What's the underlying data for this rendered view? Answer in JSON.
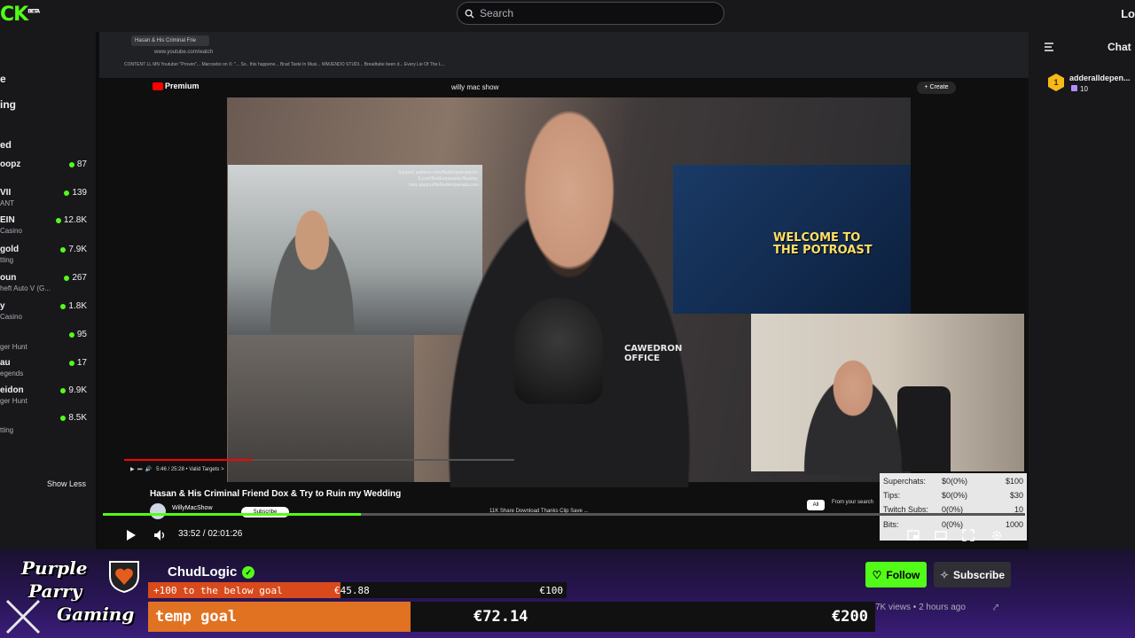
{
  "app": {
    "logo": "CK",
    "logo_badge": "BETA",
    "login_label": "Lo"
  },
  "search": {
    "placeholder": "Search"
  },
  "sidebar": {
    "headers": [
      "e",
      "ing",
      "ed"
    ],
    "items": [
      {
        "name": "oopz",
        "sub": "",
        "viewers": "87"
      },
      {
        "name": "VII",
        "sub": "ANT",
        "viewers": "139"
      },
      {
        "name": "EIN",
        "sub": "Casino",
        "viewers": "12.8K"
      },
      {
        "name": "gold",
        "sub": "tting",
        "viewers": "7.9K"
      },
      {
        "name": "oun",
        "sub": "heft Auto V (G...",
        "viewers": "267"
      },
      {
        "name": "y",
        "sub": "Casino",
        "viewers": "1.8K"
      },
      {
        "name": "",
        "sub": "ger Hunt",
        "viewers": "95"
      },
      {
        "name": "au",
        "sub": "egends",
        "viewers": "17"
      },
      {
        "name": "eidon",
        "sub": "ger Hunt",
        "viewers": "9.9K"
      },
      {
        "name": "",
        "sub": "tting",
        "viewers": "8.5K"
      }
    ],
    "show_less": "Show Less"
  },
  "embedded_browser": {
    "tab_title": "Hasan & His Criminal Frie",
    "url": "www.youtube.com/watch",
    "bookmarks": "CONTENT   LL   MN   Youtuber \"Proven\"...   Marcoebo on X: \"...   So.. this happene...   Brad Taste In Musi...   WMJENDO STUDI...   Breadtube been d...   Every Lie Of The L..."
  },
  "youtube": {
    "logo": "Premium",
    "search_value": "willy mac show",
    "create_label": "Create",
    "poster_text": "WELCOME TO THE POTROAST",
    "shirt_text": "CAWEDRON OFFICE",
    "player_time": "5:46 / 25:28 • Valid Targets >",
    "progress_fraction": 0.33,
    "video_title": "Hasan & His Criminal Friend Dox & Try to Ruin my Wedding",
    "channel": "WillyMacShow",
    "subscribe_label": "Subscribe",
    "actions": "11K   Share   Download   Thanks   Clip   Save   ...",
    "chip_all": "All",
    "chip_from": "From your search",
    "support_text": "Support: patreon.com/BadEmpanada  ko-fi.com/BadEmpanada  Bluesky: bsky.app/profile/bedempanada.com"
  },
  "goals_overlay": {
    "rows": [
      {
        "label": "Superchats:",
        "value": "$0(0%)",
        "target": "$100"
      },
      {
        "label": "Tips:",
        "value": "$0(0%)",
        "target": "$30"
      },
      {
        "label": "Twitch Subs:",
        "value": "0(0%)",
        "target": "10"
      },
      {
        "label": "Bits:",
        "value": "0(0%)",
        "target": "1000"
      }
    ]
  },
  "kick_player": {
    "time": "33:52 / 02:01:26",
    "progress_fraction": 0.28
  },
  "chat": {
    "title": "Chat",
    "user": "adderalldepen...",
    "badge": "1",
    "count": "10"
  },
  "footer": {
    "brand_lines": [
      "Purple",
      "Parry",
      "Gaming"
    ],
    "channel_name": "ChudLogic",
    "follow_label": "Follow",
    "subscribe_label": "Subscribe",
    "meta": "7K views  •  2 hours ago",
    "goal_small": {
      "text": "+100 to the below goal",
      "amount": "€45.88",
      "target": "€100",
      "fraction": 0.4588
    },
    "goal_big": {
      "text": "temp goal",
      "amount": "€72.14",
      "target": "€200",
      "fraction": 0.3607
    }
  },
  "colors": {
    "accent": "#53fc18",
    "panel": "#18181b",
    "bg": "#0e0e10",
    "goal_fill": "#e07222"
  }
}
